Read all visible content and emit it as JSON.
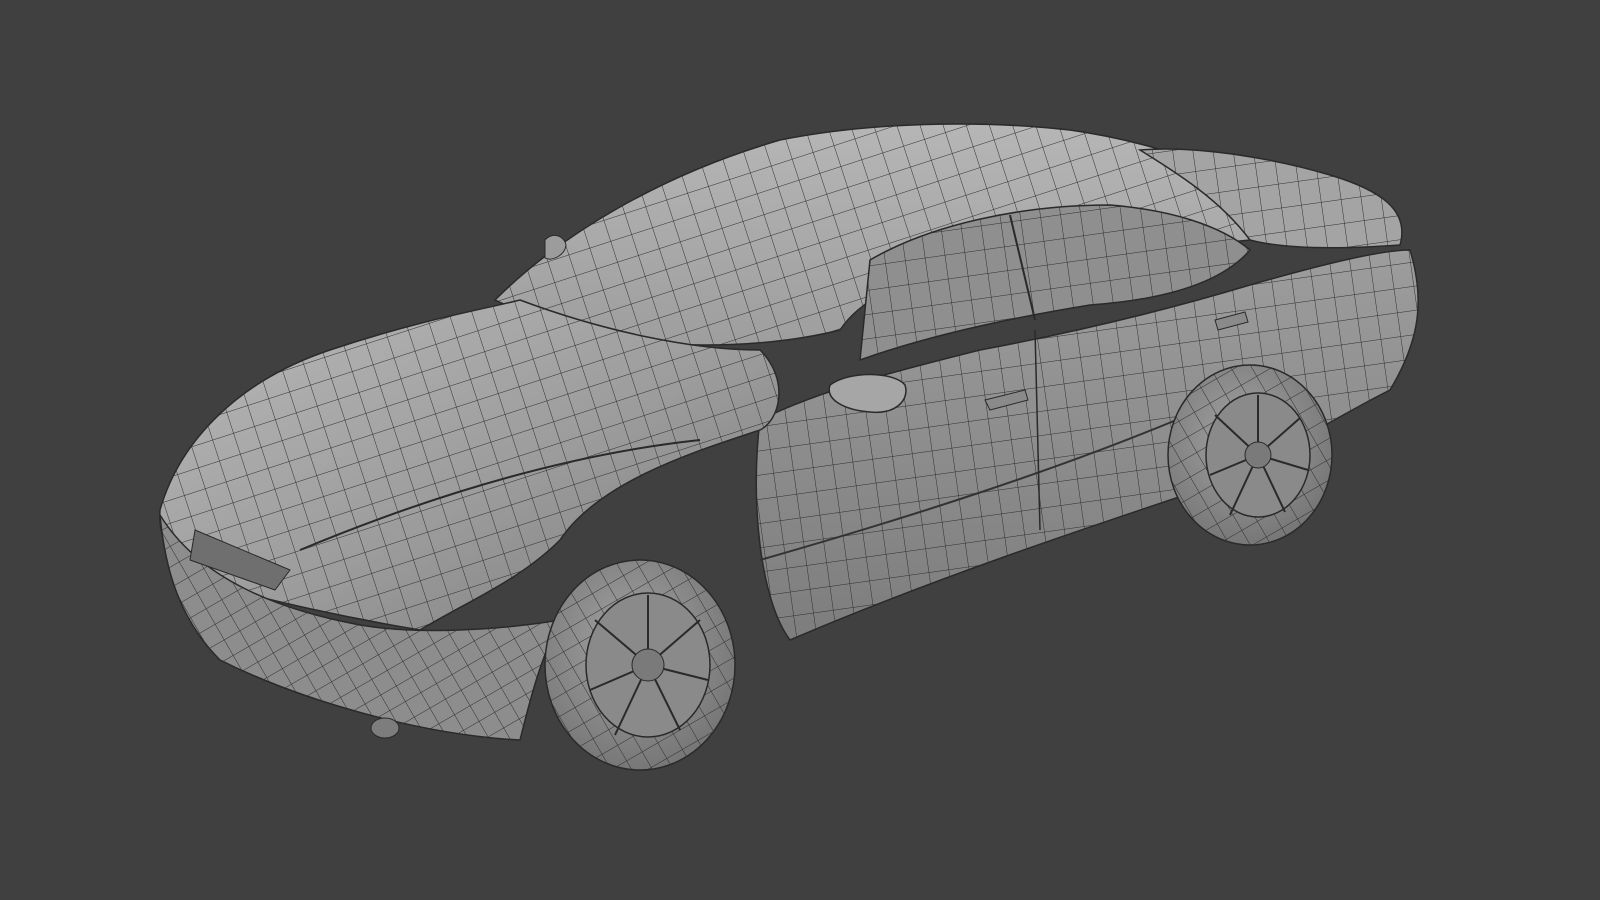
{
  "viewport": {
    "background": "#404040",
    "subject": "car-wireframe-model"
  },
  "model": {
    "shading": "solid-with-wireframe",
    "body_color": "#9a9a9a",
    "highlight_color": "#c4c4c4",
    "shadow_color": "#6b6b6b",
    "wire_color": "#2e2e2e"
  }
}
